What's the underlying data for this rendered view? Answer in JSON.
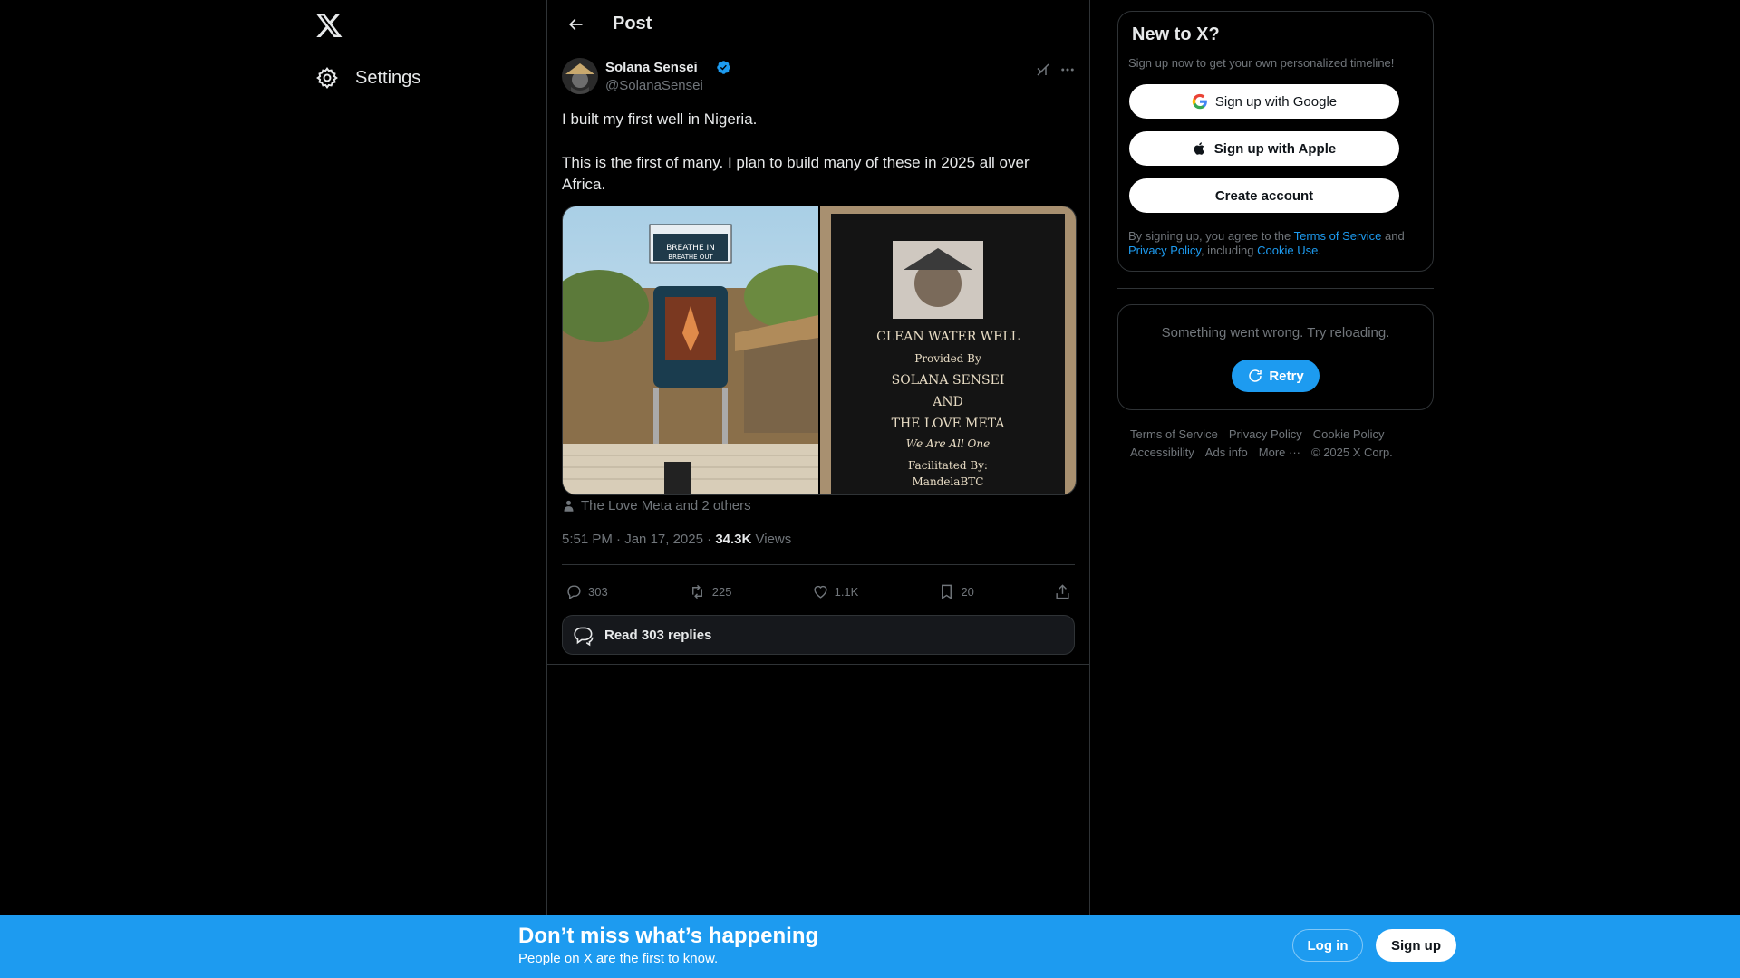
{
  "nav": {
    "logo_icon": "x-logo-icon",
    "settings_label": "Settings"
  },
  "header": {
    "title": "Post"
  },
  "tweet": {
    "author_name": "Solana Sensei",
    "author_handle": "@SolanaSensei",
    "verified": true,
    "text": "I built my first well in Nigeria.\n\nThis is the first of many. I plan to build many of these in 2025 all over Africa.",
    "tagged": "The Love Meta and 2 others",
    "time": "5:51 PM",
    "separator": "·",
    "date": "Jan 17, 2025",
    "views_count": "34.3K",
    "views_label": "Views",
    "media": {
      "left_image": {
        "sign_line1": "BREATHE IN",
        "sign_line2": "BREATHE OUT"
      },
      "right_image": {
        "plaque_lines": [
          "CLEAN WATER WELL",
          "Provided By",
          "SOLANA SENSEI",
          "AND",
          "THE LOVE META",
          "We Are All One",
          "Facilitated By:",
          "MandelaBTC"
        ]
      }
    },
    "stats": {
      "replies": "303",
      "reposts": "225",
      "likes": "1.1K",
      "bookmarks": "20"
    },
    "read_replies_label": "Read 303 replies"
  },
  "signup_card": {
    "title": "New to X?",
    "subtitle": "Sign up now to get your own personalized timeline!",
    "google_label": "Sign up with Google",
    "apple_label": "Sign up with Apple",
    "create_label": "Create account",
    "legal_prefix": "By signing up, you agree to the ",
    "terms_link": "Terms of Service",
    "legal_and": " and ",
    "privacy_link": "Privacy Policy",
    "legal_including": ", including ",
    "cookie_link": "Cookie Use",
    "legal_end": "."
  },
  "error_card": {
    "message": "Something went wrong. Try reloading.",
    "retry_label": "Retry"
  },
  "footer": {
    "terms": "Terms of Service",
    "privacy": "Privacy Policy",
    "cookie": "Cookie Policy",
    "accessibility": "Accessibility",
    "ads": "Ads info",
    "more": "More ···",
    "copyright": "© 2025 X Corp."
  },
  "bottom_bar": {
    "title": "Don’t miss what’s happening",
    "subtitle": "People on X are the first to know.",
    "login_label": "Log in",
    "signup_label": "Sign up"
  },
  "colors": {
    "accent": "#1d9bf0",
    "background": "#000000",
    "text_primary": "#e7e9ea",
    "text_secondary": "#71767b",
    "border": "#2f3336"
  }
}
